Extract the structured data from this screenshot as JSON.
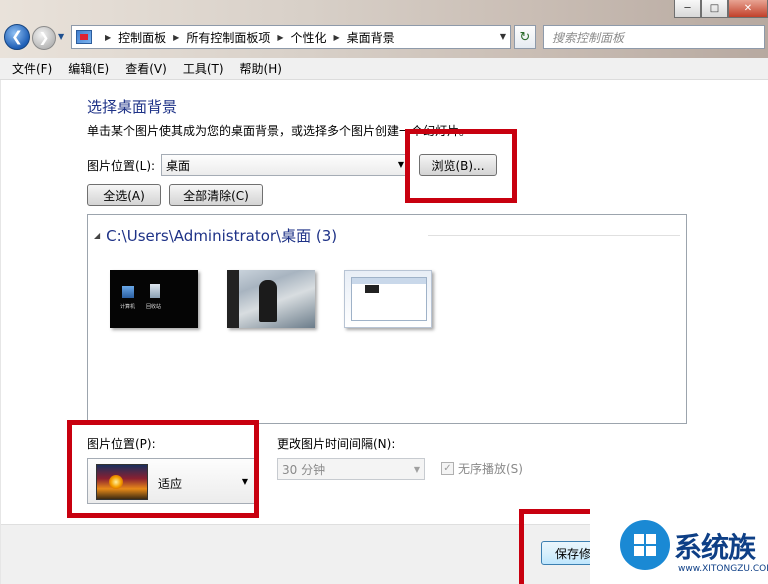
{
  "window": {
    "controls": {
      "minimize": "─",
      "maximize": "□",
      "close": "✕"
    }
  },
  "nav": {
    "back_glyph": "❮",
    "forward_glyph": "❯",
    "dropdown_glyph": "▼",
    "breadcrumbs": [
      "控制面板",
      "所有控制面板项",
      "个性化",
      "桌面背景"
    ],
    "address_dropdown_glyph": "▼",
    "refresh_glyph": "↻",
    "search_placeholder": "搜索控制面板"
  },
  "menu": {
    "items": [
      "文件(F)",
      "编辑(E)",
      "查看(V)",
      "工具(T)",
      "帮助(H)"
    ]
  },
  "main": {
    "heading": "选择桌面背景",
    "description": "单击某个图片使其成为您的桌面背景，或选择多个图片创建一个幻灯片。",
    "picture_location_label": "图片位置(L):",
    "picture_location_value": "桌面",
    "browse_button": "浏览(B)...",
    "select_all_button": "全选(A)",
    "clear_all_button": "全部清除(C)",
    "group_toggle": "◢",
    "group_title": "C:\\Users\\Administrator\\桌面 (3)",
    "thumbnails": [
      {
        "name": "desktop-icons",
        "labels": [
          "计算机",
          "回收站"
        ]
      },
      {
        "name": "photo"
      },
      {
        "name": "screenshot"
      }
    ],
    "picture_position_label": "图片位置(P):",
    "picture_position_value": "适应",
    "interval_label": "更改图片时间间隔(N):",
    "interval_value": "30 分钟",
    "shuffle_label": "无序播放(S)",
    "shuffle_checked": true,
    "save_button": "保存修改"
  },
  "watermark": {
    "text": "系统族",
    "url": "www.XITONGZU.COM"
  },
  "colors": {
    "highlight": "#c8000f",
    "heading": "#1e3287"
  }
}
